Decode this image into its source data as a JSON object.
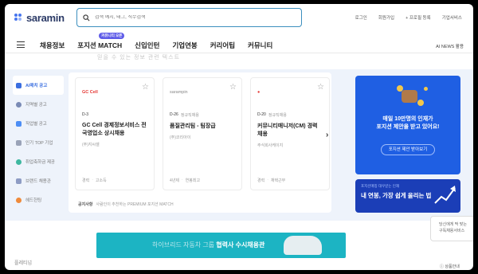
{
  "header": {
    "logo_text": "saramin",
    "search_placeholder": "검색 예시, 태그, 직무검색",
    "util_links": [
      "로그인",
      "회원가입",
      "+ 프로필 등록",
      "기업서비스"
    ]
  },
  "nav": {
    "items": [
      "채용정보",
      "포지션 MATCH",
      "신입인턴",
      "기업연봉",
      "커리어팁",
      "커뮤니티"
    ],
    "badge": "커뮤니티 오픈",
    "right": "AI NEWS 활용"
  },
  "ghost_text": "믿을 수 있는 정보 관련 텍스트",
  "sidebar": {
    "items": [
      {
        "label": "AI매치 공고",
        "active": true,
        "color": "#3b6fe0"
      },
      {
        "label": "지역별 공고",
        "active": false,
        "color": "#7a8bb5"
      },
      {
        "label": "직업별 공고",
        "active": false,
        "color": "#4d8ef5"
      },
      {
        "label": "인기 TOP 기업",
        "active": false,
        "color": "#9aa3b8"
      },
      {
        "label": "취업축하금 제공",
        "active": false,
        "color": "#3fb8a0"
      },
      {
        "label": "브랜드 채용관",
        "active": false,
        "color": "#8e9cc4"
      },
      {
        "label": "헤드헌팅",
        "active": false,
        "color": "#ef8a3b"
      }
    ]
  },
  "cards": [
    {
      "logo": "GC Cell",
      "logo_color": "#e53935",
      "dday": "D-3",
      "tag": "",
      "title": "GC Cell 경제정보서비스 전국영업소 상시채용",
      "company": "(주)지씨셀",
      "footer": [
        "경력",
        "고소득"
      ]
    },
    {
      "logo": "sarampin",
      "logo_color": "#888888",
      "dday": "D-26",
      "tag": "정규직채용",
      "title": "품질관리팀 - 팀장급",
      "company": "(주)코리아이",
      "footer": [
        "4년제",
        "연봉최고"
      ]
    },
    {
      "logo": "●",
      "logo_color": "#e53935",
      "dday": "D-20",
      "tag": "정규직채용",
      "title": "커뮤니티매니저(CM) 경력 채용",
      "company": "주식회사케이지",
      "footer": [
        "경력",
        "재택근무"
      ]
    }
  ],
  "notice": {
    "label": "공지사항",
    "text": "사람인이 추천하는 PREMIUM 포지션 MATCH"
  },
  "promo": {
    "line1": "매일 10만명의 인재가",
    "line2": "포지션 제안을 받고 있어요!",
    "button": "포지션 제안 받아보기"
  },
  "banner2": {
    "small": "포지션매칭 대우받는 인재",
    "big": "내 연봉, 가장 쉽게 올리는 법"
  },
  "tooltip": {
    "line1": "당신에게 딱 맞는",
    "line2": "구독채용서비스"
  },
  "ad": {
    "dim": "하이브리드 자동차 그룹",
    "bold": "협력사 수시채용관"
  },
  "bottom": {
    "left": "플레티넘",
    "right": "ⓘ 상품안내"
  }
}
